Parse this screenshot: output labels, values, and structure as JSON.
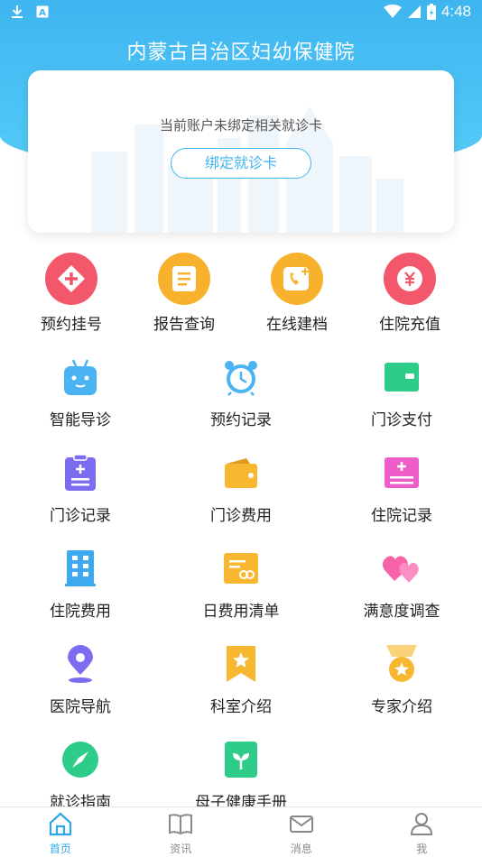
{
  "status_bar": {
    "time": "4:48"
  },
  "header": {
    "title": "内蒙古自治区妇幼保健院"
  },
  "card": {
    "message": "当前账户未绑定相关就诊卡",
    "bind_button": "绑定就诊卡"
  },
  "quick_actions": [
    {
      "label": "预约挂号",
      "icon": "plus-diamond-icon",
      "color": "#f2576b"
    },
    {
      "label": "报告查询",
      "icon": "document-icon",
      "color": "#f8b12c"
    },
    {
      "label": "在线建档",
      "icon": "phone-add-icon",
      "color": "#f8b12c"
    },
    {
      "label": "住院充值",
      "icon": "yen-coin-icon",
      "color": "#f2576b"
    }
  ],
  "services": [
    {
      "label": "智能导诊",
      "icon": "robot-icon",
      "color": "#4ab4f2"
    },
    {
      "label": "预约记录",
      "icon": "alarm-clock-icon",
      "color": "#4ab4f2"
    },
    {
      "label": "门诊支付",
      "icon": "wallet-icon",
      "color": "#2dcc89"
    },
    {
      "label": "门诊记录",
      "icon": "clipboard-icon",
      "color": "#7b6cf0"
    },
    {
      "label": "门诊费用",
      "icon": "purse-icon",
      "color": "#f7b731"
    },
    {
      "label": "住院记录",
      "icon": "medical-record-icon",
      "color": "#ee5ec9"
    },
    {
      "label": "住院费用",
      "icon": "building-icon",
      "color": "#3fa9ef"
    },
    {
      "label": "日费用清单",
      "icon": "bill-icon",
      "color": "#f7b731"
    },
    {
      "label": "满意度调查",
      "icon": "hearts-icon",
      "color": "#f763a8"
    },
    {
      "label": "医院导航",
      "icon": "location-pin-icon",
      "color": "#7b6cf0"
    },
    {
      "label": "科室介绍",
      "icon": "bookmark-star-icon",
      "color": "#f7b731"
    },
    {
      "label": "专家介绍",
      "icon": "medal-icon",
      "color": "#f7b731"
    },
    {
      "label": "就诊指南",
      "icon": "compass-icon",
      "color": "#2dcc89"
    },
    {
      "label": "母子健康手册",
      "icon": "sprout-book-icon",
      "color": "#2dcc89"
    }
  ],
  "bottom_nav": [
    {
      "label": "首页",
      "icon": "home-icon",
      "active": true
    },
    {
      "label": "资讯",
      "icon": "book-icon",
      "active": false
    },
    {
      "label": "消息",
      "icon": "mail-icon",
      "active": false
    },
    {
      "label": "我",
      "icon": "user-icon",
      "active": false
    }
  ],
  "colors": {
    "primary": "#3fb3ee",
    "header": "#4cc3f5"
  }
}
